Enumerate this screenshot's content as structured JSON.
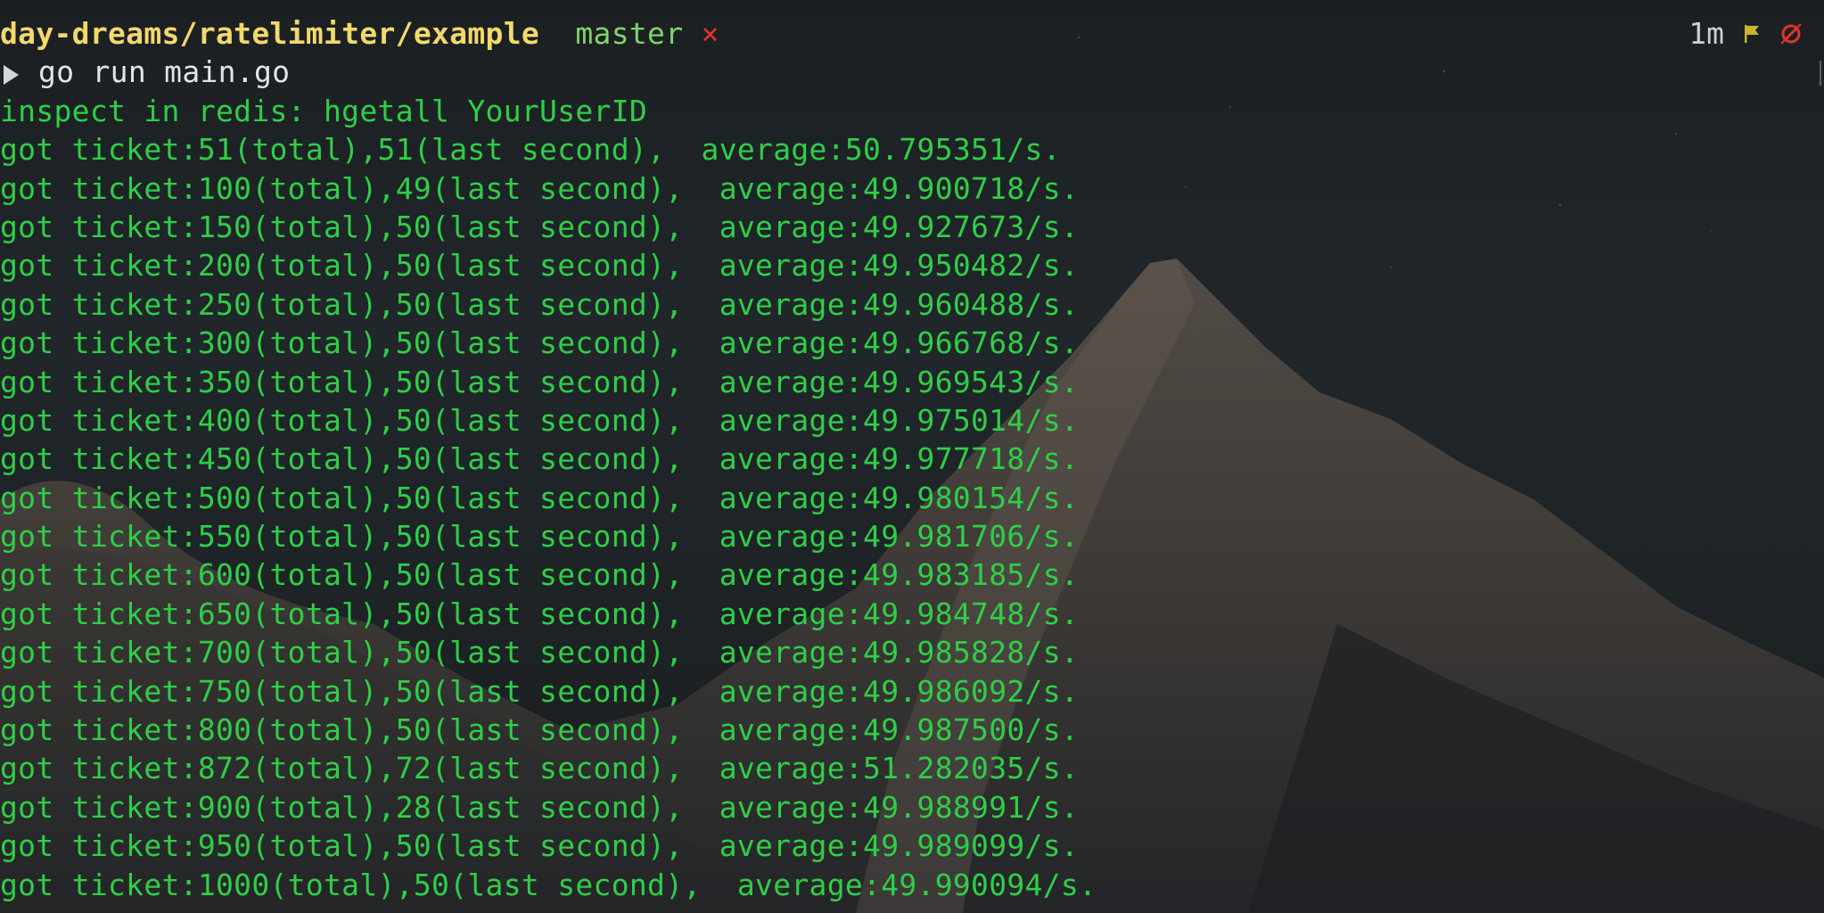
{
  "prompt": {
    "path": "day-dreams/ratelimiter/example",
    "branch": "master",
    "dirty_marker": "×",
    "command": "go run main.go"
  },
  "status": {
    "elapsed": "1m",
    "flag_icon": "flag-icon",
    "no_git_icon": "no-signal-icon"
  },
  "output": [
    "inspect in redis: hgetall YourUserID",
    "got ticket:51(total),51(last second),  average:50.795351/s.",
    "got ticket:100(total),49(last second),  average:49.900718/s.",
    "got ticket:150(total),50(last second),  average:49.927673/s.",
    "got ticket:200(total),50(last second),  average:49.950482/s.",
    "got ticket:250(total),50(last second),  average:49.960488/s.",
    "got ticket:300(total),50(last second),  average:49.966768/s.",
    "got ticket:350(total),50(last second),  average:49.969543/s.",
    "got ticket:400(total),50(last second),  average:49.975014/s.",
    "got ticket:450(total),50(last second),  average:49.977718/s.",
    "got ticket:500(total),50(last second),  average:49.980154/s.",
    "got ticket:550(total),50(last second),  average:49.981706/s.",
    "got ticket:600(total),50(last second),  average:49.983185/s.",
    "got ticket:650(total),50(last second),  average:49.984748/s.",
    "got ticket:700(total),50(last second),  average:49.985828/s.",
    "got ticket:750(total),50(last second),  average:49.986092/s.",
    "got ticket:800(total),50(last second),  average:49.987500/s.",
    "got ticket:872(total),72(last second),  average:51.282035/s.",
    "got ticket:900(total),28(last second),  average:49.988991/s.",
    "got ticket:950(total),50(last second),  average:49.989099/s.",
    "got ticket:1000(total),50(last second),  average:49.990094/s."
  ],
  "colors": {
    "output_text": "#2fcf47",
    "path": "#f2d96b",
    "branch": "#7fd46a",
    "dirty": "#e0342c",
    "flag": "#c9b32c",
    "no_git": "#e0342c"
  }
}
